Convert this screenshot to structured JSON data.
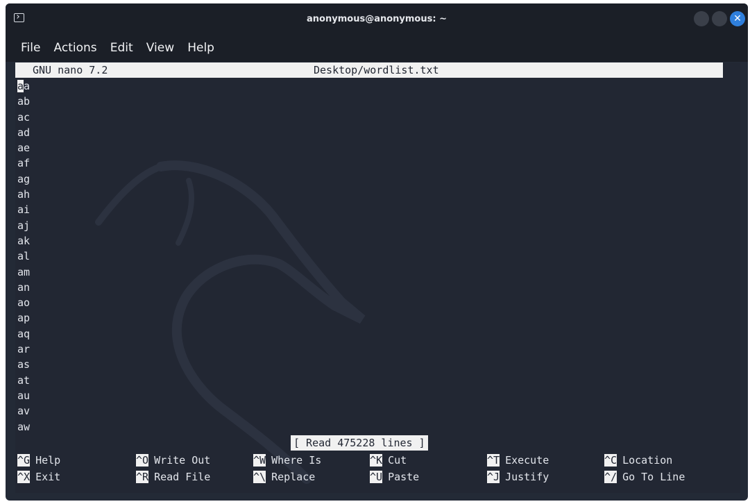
{
  "window": {
    "title": "anonymous@anonymous: ~",
    "close_glyph": "✕"
  },
  "menu": [
    "File",
    "Actions",
    "Edit",
    "View",
    "Help"
  ],
  "nano": {
    "version": "GNU nano 7.2",
    "filename": "Desktop/wordlist.txt",
    "cursor_char": "a",
    "first_line_rest": "a",
    "lines": [
      "ab",
      "ac",
      "ad",
      "ae",
      "af",
      "ag",
      "ah",
      "ai",
      "aj",
      "ak",
      "al",
      "am",
      "an",
      "ao",
      "ap",
      "aq",
      "ar",
      "as",
      "at",
      "au",
      "av",
      "aw"
    ],
    "status": "[ Read 475228 lines ]",
    "shortcuts": [
      {
        "key": "^G",
        "label": "Help"
      },
      {
        "key": "^O",
        "label": "Write Out"
      },
      {
        "key": "^W",
        "label": "Where Is"
      },
      {
        "key": "^K",
        "label": "Cut"
      },
      {
        "key": "^T",
        "label": "Execute"
      },
      {
        "key": "^C",
        "label": "Location"
      },
      {
        "key": "^X",
        "label": "Exit"
      },
      {
        "key": "^R",
        "label": "Read File"
      },
      {
        "key": "^\\",
        "label": "Replace"
      },
      {
        "key": "^U",
        "label": "Paste"
      },
      {
        "key": "^J",
        "label": "Justify"
      },
      {
        "key": "^/",
        "label": "Go To Line"
      }
    ]
  },
  "colors": {
    "terminal_bg": "#222733",
    "titlebar_bg": "#1b1f27",
    "close_button": "#2f7fdc"
  }
}
